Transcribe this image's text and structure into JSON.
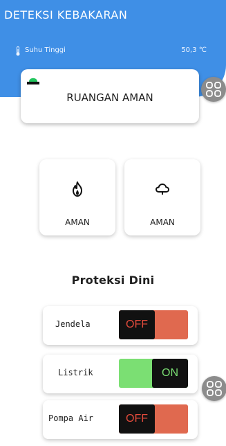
{
  "header": {
    "title": "DETEKSI KEBAKARAN",
    "temperature_label": "Suhu Tinggi",
    "temperature_value": "50,3 ℃",
    "background_color": "#3f8fe6"
  },
  "status": {
    "text": "RUANGAN AMAN",
    "icon": "alarm-light-icon",
    "icon_color": "#22c55e"
  },
  "sensors": [
    {
      "icon": "fire-icon",
      "label": "AMAN"
    },
    {
      "icon": "cloud-icon",
      "label": "AMAN"
    }
  ],
  "section_title": "Proteksi Dini",
  "controls": [
    {
      "label": "Jendela",
      "state": "OFF"
    },
    {
      "label": "Listrik",
      "state": "ON"
    },
    {
      "label": "Pompa Air",
      "state": "OFF"
    }
  ],
  "floating_buttons": [
    {
      "icon": "grid-menu-icon"
    },
    {
      "icon": "grid-menu-icon"
    }
  ],
  "colors": {
    "off_background": "#e0694f",
    "off_text": "#e34b3c",
    "on_background": "#7bdf73",
    "knob": "#111111"
  }
}
